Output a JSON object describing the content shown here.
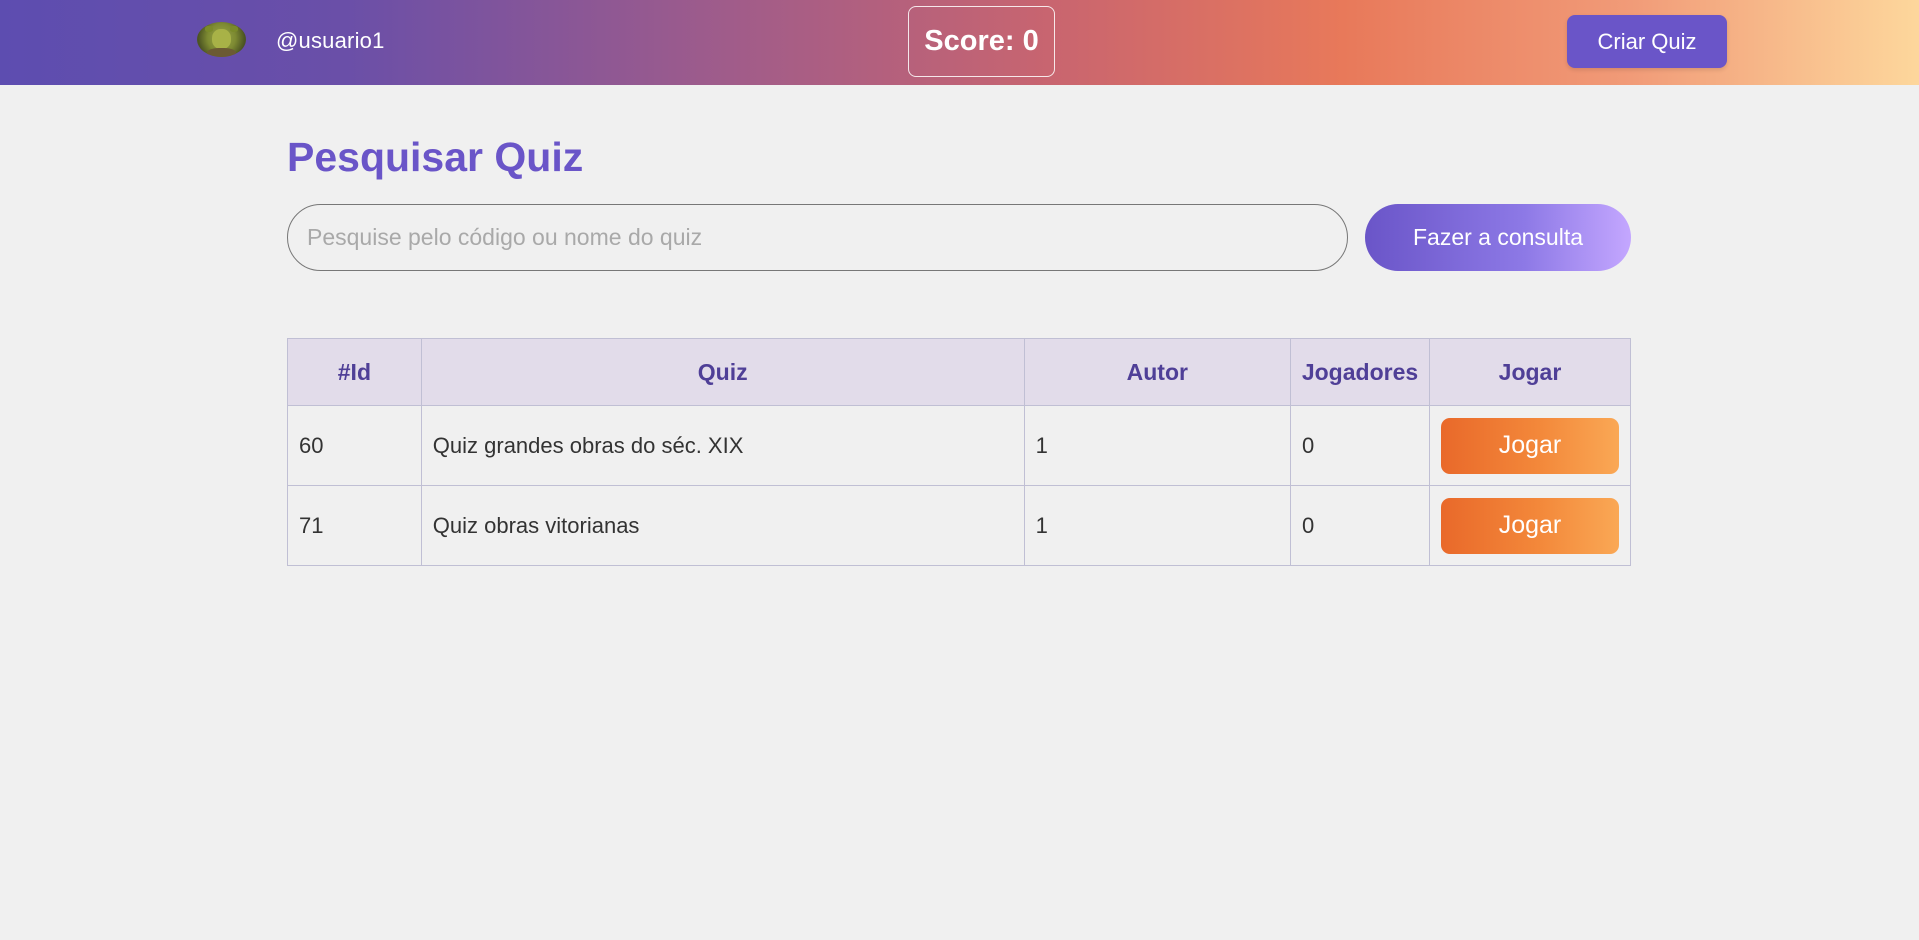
{
  "header": {
    "username": "@usuario1",
    "score_label": "Score: 0",
    "create_quiz_label": "Criar Quiz"
  },
  "main": {
    "title": "Pesquisar Quiz",
    "search": {
      "placeholder": "Pesquise pelo código ou nome do quiz",
      "value": "",
      "button_label": "Fazer a consulta"
    },
    "table": {
      "headers": [
        "#Id",
        "Quiz",
        "Autor",
        "Jogadores",
        "Jogar"
      ],
      "rows": [
        {
          "id": "60",
          "quiz": "Quiz grandes obras do séc. XIX",
          "autor": "1",
          "jogadores": "0",
          "action_label": "Jogar"
        },
        {
          "id": "71",
          "quiz": "Quiz obras vitorianas",
          "autor": "1",
          "jogadores": "0",
          "action_label": "Jogar"
        }
      ]
    }
  },
  "colors": {
    "accent": "#6a55c8",
    "play_button": "#f08535",
    "table_header_bg": "#e2dcea",
    "page_bg": "#f0f0f0"
  },
  "icons": {
    "avatar": "ogre-avatar-icon"
  }
}
